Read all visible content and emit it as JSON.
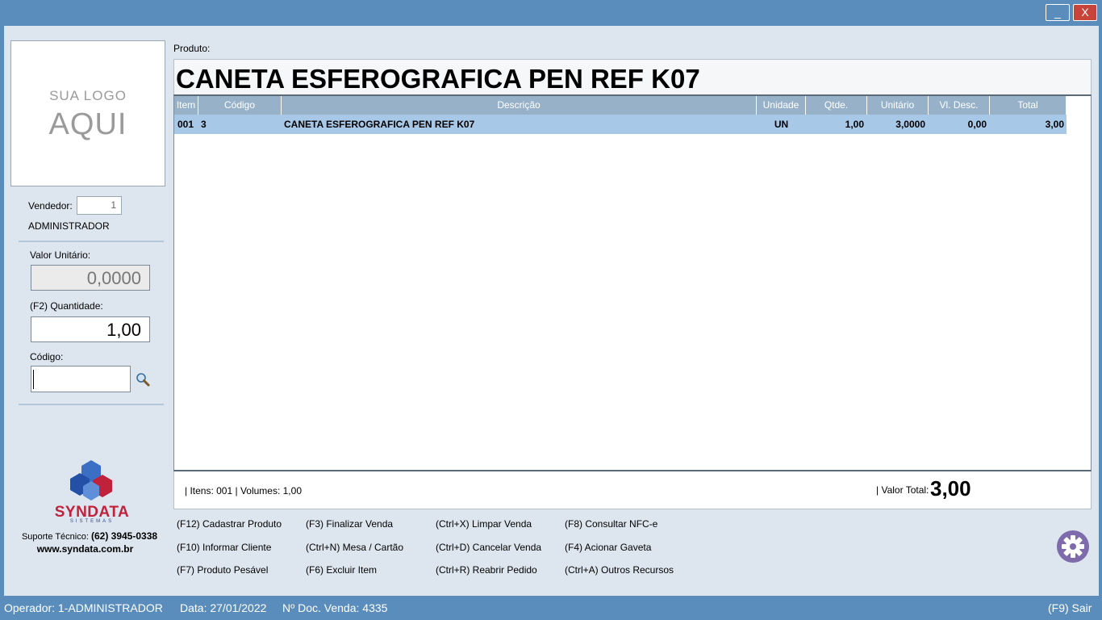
{
  "window": {
    "minimize_label": "_",
    "close_label": "X"
  },
  "logo": {
    "line1": "SUA LOGO",
    "line2": "AQUI"
  },
  "seller": {
    "label": "Vendedor:",
    "code": "1",
    "name": "ADMINISTRADOR"
  },
  "entry": {
    "unit_price_label": "Valor Unitário:",
    "unit_price_value": "0,0000",
    "quantity_label": "(F2) Quantidade:",
    "quantity_value": "1,00",
    "code_label": "Código:",
    "code_value": ""
  },
  "brand": {
    "name": "SYNDATA",
    "tagline": "SISTEMAS",
    "support_label": "Suporte Técnico:",
    "support_phone": "(62) 3945-0338",
    "website": "www.syndata.com.br"
  },
  "product": {
    "caption": "Produto:",
    "current_name": "CANETA ESFEROGRAFICA PEN REF K07"
  },
  "table": {
    "columns": [
      "Item",
      "Código",
      "Descrição",
      "Unidade",
      "Qtde.",
      "Unitário",
      "Vl. Desc.",
      "Total"
    ],
    "rows": [
      {
        "item": "001",
        "code": "3",
        "description": "CANETA ESFEROGRAFICA PEN REF K07",
        "unit": "UN",
        "qty": "1,00",
        "unit_price": "3,0000",
        "discount": "0,00",
        "total": "3,00"
      }
    ]
  },
  "summary": {
    "counts": "| Itens: 001 | Volumes: 1,00",
    "total_label": "| Valor Total:",
    "total_value": "3,00"
  },
  "shortcuts": {
    "col1": [
      "(F12) Cadastrar Produto",
      "(F10) Informar Cliente",
      "(F7) Produto Pesável"
    ],
    "col2": [
      "(F3) Finalizar Venda",
      "(Ctrl+N) Mesa / Cartão",
      "(F6) Excluir Item"
    ],
    "col3": [
      "(Ctrl+X) Limpar Venda",
      "(Ctrl+D) Cancelar Venda",
      "(Ctrl+R) Reabrir Pedido"
    ],
    "col4": [
      "(F8) Consultar NFC-e",
      "(F4) Acionar Gaveta",
      "(Ctrl+A) Outros Recursos"
    ]
  },
  "footer": {
    "operator": "Operador: 1-ADMINISTRADOR",
    "date": "Data: 27/01/2022",
    "doc": "Nº Doc. Venda: 4335",
    "exit": "(F9) Sair"
  },
  "colors": {
    "accent": "#5a8dbb",
    "panel": "#dde6ee",
    "grid_header": "#97b2c8",
    "row_selected": "#a8c8e7",
    "brand_red": "#c0213b",
    "settings": "#7d6bab"
  },
  "icons": {
    "search": "magnifier-icon",
    "settings": "gear-icon"
  }
}
